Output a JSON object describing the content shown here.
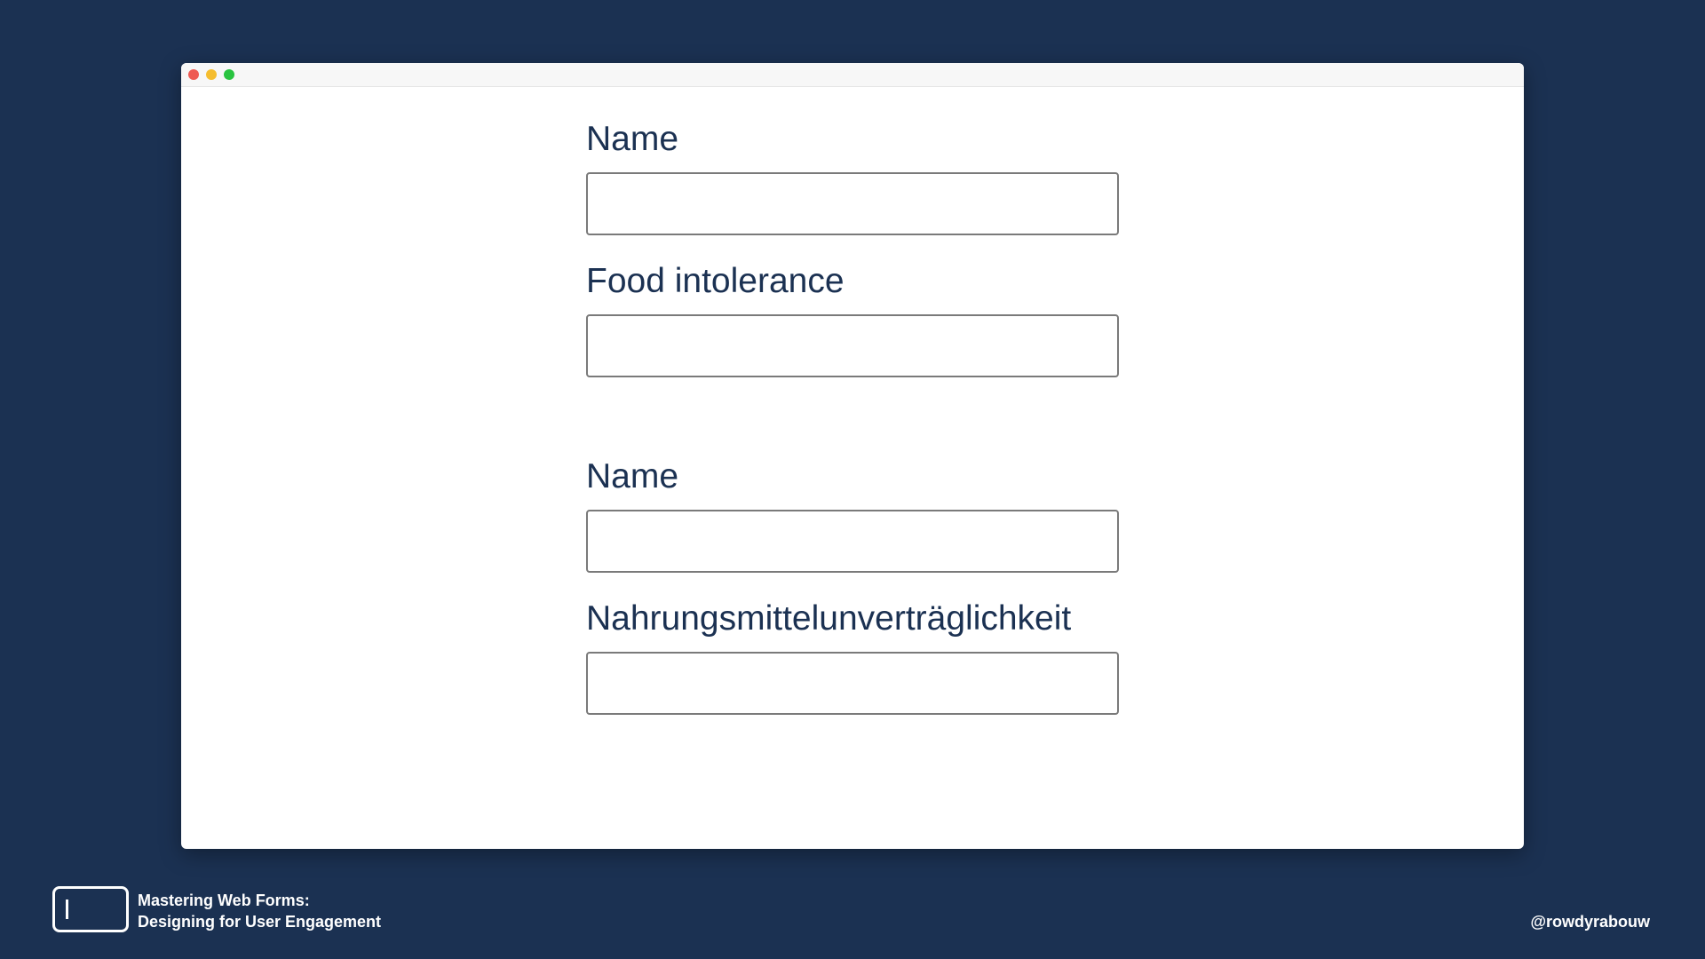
{
  "form": {
    "fields": [
      {
        "label": "Name",
        "value": ""
      },
      {
        "label": "Food intolerance",
        "value": ""
      },
      {
        "label": "Name",
        "value": ""
      },
      {
        "label": "Nahrungsmittelunverträglichkeit",
        "value": ""
      }
    ]
  },
  "footer": {
    "talk_title_line1": "Mastering Web Forms:",
    "talk_title_line2": "Designing for User Engagement",
    "handle": "@rowdyrabouw"
  },
  "icons": {
    "window_controls": [
      "close-dot",
      "minimize-dot",
      "maximize-dot"
    ],
    "logo": "input-cursor-icon"
  },
  "colors": {
    "background": "#1b3152",
    "label_text": "#1b3152",
    "input_border": "#7a7a7a",
    "window_background": "#ffffff"
  }
}
